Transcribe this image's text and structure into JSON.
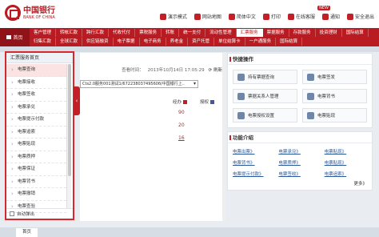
{
  "brand": {
    "name_cn": "中国银行",
    "name_en": "BANK OF CHINA",
    "color": "#b81c22"
  },
  "top_links": [
    {
      "id": "demo",
      "label": "演示模式"
    },
    {
      "id": "nav",
      "label": "网站地图"
    },
    {
      "id": "lang",
      "label": "简体中文"
    },
    {
      "id": "print",
      "label": "打印"
    },
    {
      "id": "help",
      "label": "在线客服"
    },
    {
      "id": "notice",
      "label": "通知"
    },
    {
      "id": "logout",
      "label": "安全退出"
    }
  ],
  "new_badge": "NEW",
  "nav": {
    "home": "首页",
    "row1": [
      "客户管理",
      "转帐汇款",
      "跨行汇款",
      "代收代付",
      "票税服务",
      "转账",
      "统一支付",
      "流动性管理",
      "汇票服务",
      "票据服务",
      "存款服务",
      "投资理财",
      "国际结算"
    ],
    "row2": [
      "归集汇款",
      "全球汇款",
      "供应链融资",
      "电子票据",
      "电子商务",
      "养老金",
      "资产托管",
      "单位结算卡",
      "一户通服务",
      "国际结算"
    ],
    "active_row1": "汇票服务"
  },
  "left_panel": {
    "title": "汇票服务首页",
    "items": [
      "电票查询",
      "电票接收",
      "电票签收",
      "电票承兑",
      "电票提示付款",
      "电票追索",
      "电票贴现",
      "电票质押",
      "电票保证",
      "电票背书",
      "电票撤销",
      "电票查验"
    ],
    "selected": "电票查询",
    "footer_label": "自动弹出"
  },
  "main": {
    "time_label": "查看时间：",
    "time_value": "2013年10月14日 17:05:29",
    "refresh_label": "刷新",
    "select_value": "Cts2.0服务001测试1/67223803749560б/中国银行上..",
    "legend": [
      {
        "label": "经办",
        "color": "#c21f26"
      },
      {
        "label": "授权",
        "color": "#3a59a8"
      }
    ],
    "counts": [
      "90",
      "20",
      "16"
    ]
  },
  "quick_ops": {
    "title": "快捷操作",
    "items": [
      "持有票据查询",
      "电票签发",
      "票据关系人管理",
      "电票背书",
      "电票授权设置",
      "电票贴现"
    ]
  },
  "features": {
    "title": "功能介绍",
    "items": [
      "电票出票》",
      "电票承兑》",
      "电票贴现》",
      "电票背书》",
      "电票质押》",
      "电票贴现》",
      "电票提示付款》",
      "电票签收》",
      "电票追索》"
    ],
    "more_label": "更多》"
  },
  "bottom_tab": "首页"
}
